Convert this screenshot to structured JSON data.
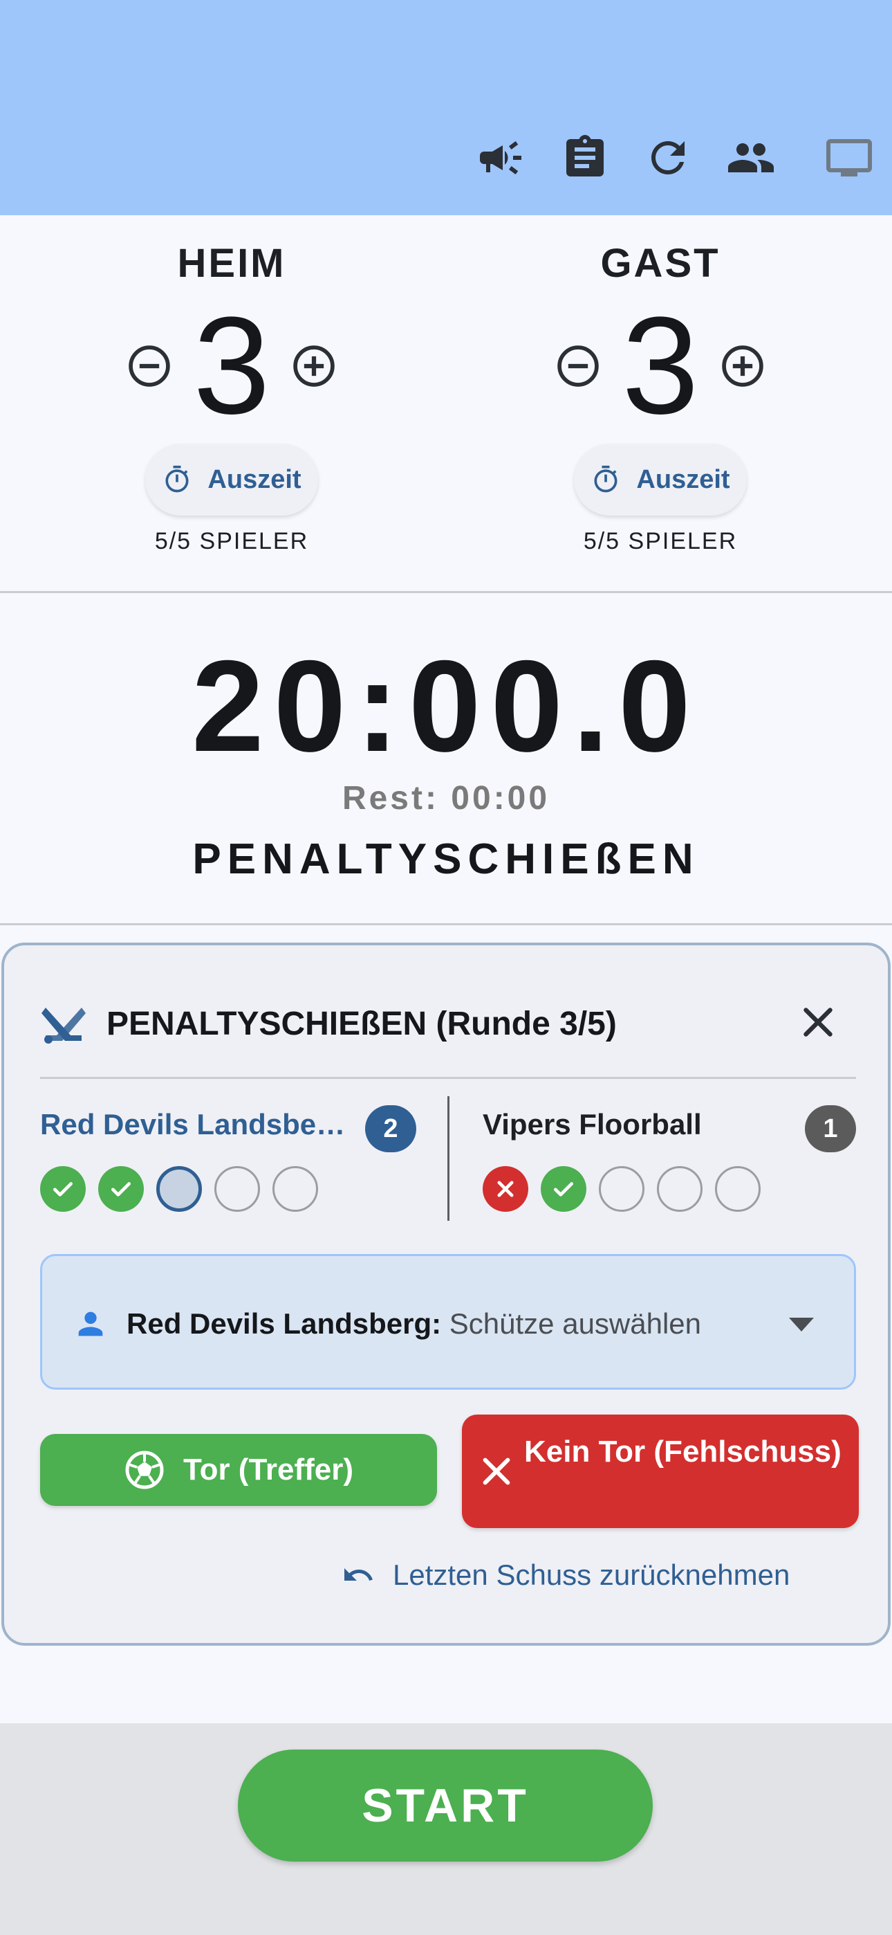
{
  "toolbar": {
    "icons": [
      "megaphone-icon",
      "clipboard-icon",
      "refresh-icon",
      "people-icon",
      "tv-icon"
    ]
  },
  "scoreboard": {
    "home": {
      "label": "HEIM",
      "score": "3",
      "timeout_label": "Auszeit",
      "players": "5/5 SPIELER"
    },
    "away": {
      "label": "GAST",
      "score": "3",
      "timeout_label": "Auszeit",
      "players": "5/5 SPIELER"
    }
  },
  "clock": {
    "time": "20:00.0",
    "rest": "Rest: 00:00",
    "period": "PENALTYSCHIEßEN"
  },
  "penalty": {
    "title": "PENALTYSCHIEßEN (Runde 3/5)",
    "home": {
      "name": "Red Devils Landsbe…",
      "goals": "2",
      "shots": [
        "hit",
        "hit",
        "current",
        "empty",
        "empty"
      ]
    },
    "away": {
      "name": "Vipers Floorball",
      "goals": "1",
      "shots": [
        "miss",
        "hit",
        "empty",
        "empty",
        "empty"
      ]
    },
    "shooter": {
      "team": "Red Devils Landsberg:",
      "placeholder": "Schütze auswählen"
    },
    "goal_button": "Tor (Treffer)",
    "miss_button": "Kein Tor (Fehlschuss)",
    "undo_label": "Letzten Schuss zurücknehmen"
  },
  "footer": {
    "start_label": "START"
  },
  "colors": {
    "topbar": "#9ec6fb",
    "accent": "#2f5f93",
    "success": "#4caf50",
    "danger": "#d32f2f"
  }
}
